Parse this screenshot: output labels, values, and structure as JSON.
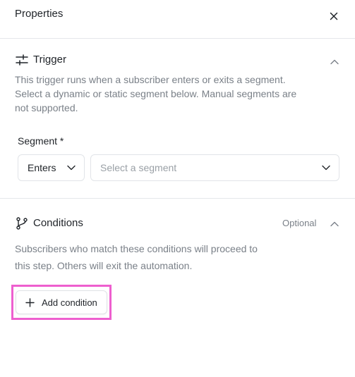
{
  "header": {
    "title": "Properties",
    "close_icon": "close-icon"
  },
  "trigger": {
    "icon": "sliders-icon",
    "title": "Trigger",
    "collapse_icon": "chevron-up-icon",
    "description_lines": [
      "This trigger runs when a subscriber enters or exits a segment.",
      "Select a dynamic or static segment below. Manual segments are",
      "not supported."
    ],
    "segment_label": "Segment *",
    "event_select": {
      "value": "Enters",
      "icon": "chevron-down-icon"
    },
    "segment_select": {
      "placeholder": "Select a segment",
      "icon": "chevron-down-icon"
    }
  },
  "conditions": {
    "icon": "git-branch-icon",
    "title": "Conditions",
    "optional_label": "Optional",
    "collapse_icon": "chevron-up-icon",
    "description_lines": [
      "Subscribers who match these conditions will proceed to",
      "this step. Others will exit the automation."
    ],
    "add_button": {
      "label": "Add condition",
      "icon": "plus-icon"
    }
  },
  "colors": {
    "highlight": "#ee5fcf",
    "muted_text": "#7a8088",
    "border": "#e5e7eb"
  }
}
